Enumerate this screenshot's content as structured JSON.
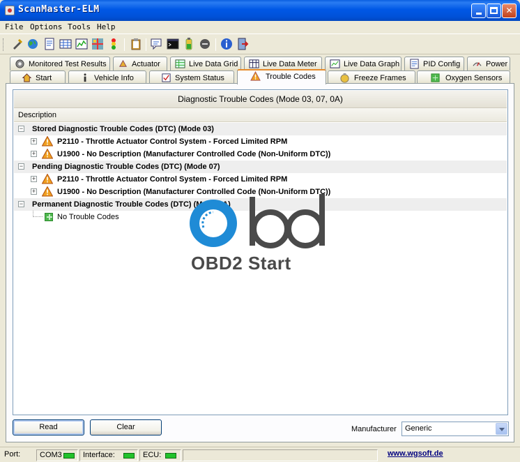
{
  "window": {
    "title": "ScanMaster-ELM"
  },
  "menu": [
    "File",
    "Options",
    "Tools",
    "Help"
  ],
  "toolbar_icons": [
    "connect-icon",
    "globe-icon",
    "document-icon",
    "grid-icon",
    "graph-icon",
    "map-icon",
    "traffic-icon",
    "clipboard-icon",
    "chat-icon",
    "terminal-icon",
    "battery-icon",
    "disconnect-icon",
    "info-icon",
    "exit-icon"
  ],
  "tabs_row1": [
    {
      "label": "Monitored Test Results",
      "icon": "gear-icon"
    },
    {
      "label": "Actuator",
      "icon": "actuator-icon"
    },
    {
      "label": "Live Data Grid",
      "icon": "grid-icon"
    },
    {
      "label": "Live Data Meter",
      "icon": "meter-icon"
    },
    {
      "label": "Live Data Graph",
      "icon": "graph-icon"
    },
    {
      "label": "PID Config",
      "icon": "config-icon"
    },
    {
      "label": "Power",
      "icon": "power-icon"
    }
  ],
  "tabs_row2": [
    {
      "label": "Start",
      "icon": "home-icon"
    },
    {
      "label": "Vehicle Info",
      "icon": "info-icon"
    },
    {
      "label": "System Status",
      "icon": "checklist-icon"
    },
    {
      "label": "Trouble Codes",
      "icon": "warning-icon",
      "active": true
    },
    {
      "label": "Freeze Frames",
      "icon": "freeze-icon"
    },
    {
      "label": "Oxygen Sensors",
      "icon": "sensor-icon"
    }
  ],
  "dtc": {
    "title": "Diagnostic Trouble Codes (Mode 03, 07, 0A)",
    "column": "Description",
    "groups": [
      {
        "label": "Stored Diagnostic Trouble Codes (DTC) (Mode 03)",
        "items": [
          "P2110 - Throttle Actuator Control System - Forced Limited RPM",
          "U1900 - No Description (Manufacturer Controlled Code (Non-Uniform DTC))"
        ]
      },
      {
        "label": "Pending Diagnostic Trouble Codes (DTC) (Mode 07)",
        "items": [
          "P2110 - Throttle Actuator Control System - Forced Limited RPM",
          "U1900 - No Description (Manufacturer Controlled Code (Non-Uniform DTC))"
        ]
      },
      {
        "label": "Permanent Diagnostic Trouble Codes (DTC) (Mode 0A)",
        "items": [
          "No Trouble Codes"
        ]
      }
    ]
  },
  "watermark": {
    "logo_text": "OBD",
    "text": "OBD2 Start"
  },
  "buttons": {
    "read": "Read",
    "clear": "Clear"
  },
  "manufacturer": {
    "label": "Manufacturer",
    "value": "Generic"
  },
  "status": {
    "port_label": "Port:",
    "port_value": "COM3",
    "interface_label": "Interface:",
    "ecu_label": "ECU:",
    "website": "www.wgsoft.de",
    "led_color": "#22c22a"
  },
  "colors": {
    "accent_tab": "#e68b2c",
    "title_blue": "#0058e6",
    "warning": "#f0a020"
  }
}
